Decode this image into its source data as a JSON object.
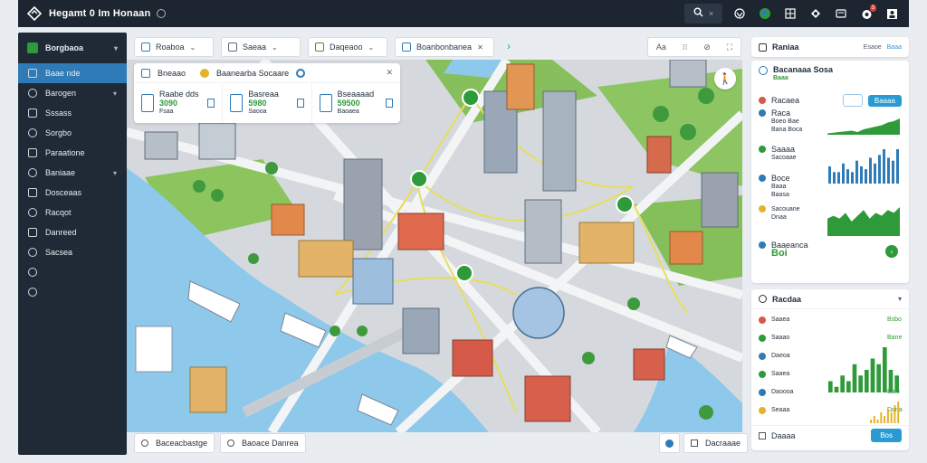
{
  "app": {
    "title": "Hegamt 0 Im Honaan"
  },
  "topbar": {
    "search_icon": "search-icon",
    "search_extra": "×",
    "icons": [
      "wifi-icon",
      "globe-icon",
      "flag-icon",
      "shield-icon",
      "message-icon",
      "alert-icon",
      "user-icon"
    ],
    "alert_badge": "3"
  },
  "sidebar": {
    "header": "Borgbaoa",
    "items": [
      {
        "label": "Baae nde",
        "active": true,
        "chevron": false
      },
      {
        "label": "Barogen",
        "active": false,
        "chevron": true
      },
      {
        "label": "Sssass",
        "active": false,
        "chevron": false
      },
      {
        "label": "Sorgbo",
        "active": false,
        "chevron": false
      },
      {
        "label": "Paraatione",
        "active": false,
        "chevron": false
      },
      {
        "label": "Baniaae",
        "active": false,
        "chevron": true
      },
      {
        "label": "Dosceaas",
        "active": false,
        "chevron": false
      },
      {
        "label": "Racqot",
        "active": false,
        "chevron": false
      },
      {
        "label": "Danreed",
        "active": false,
        "chevron": false
      },
      {
        "label": "Sacsea",
        "active": false,
        "chevron": false
      }
    ]
  },
  "filters": [
    {
      "label": "Roaboa",
      "color": "#2e7bb7"
    },
    {
      "label": "Saeaa",
      "color": "#5a6877"
    },
    {
      "label": "Daqeaoo",
      "color": "#2f9a3a"
    },
    {
      "label": "Boanbonbanea",
      "color": "#2e7bb7"
    }
  ],
  "filter_extra": "›",
  "map_controls": [
    "Aa",
    "⁝⁝",
    "⊘",
    "⛶"
  ],
  "stat_card": {
    "title": "Bneaao",
    "subtitle": "Baanearba Socaare",
    "close": "✕",
    "columns": [
      {
        "label": "Raabe dds",
        "value": "3090",
        "sub": "Fsaa"
      },
      {
        "label": "Basreaa",
        "value": "5980",
        "sub": "Saooa"
      },
      {
        "label": "Bseaaaad",
        "value": "59500",
        "sub": "Baoaea"
      }
    ]
  },
  "bottom_left": [
    {
      "label": "Baceacbastge"
    },
    {
      "label": "Baoace Danrea"
    }
  ],
  "bottom_right": {
    "label": "Dacraaae"
  },
  "right_top": {
    "title": "Raniaa",
    "box_label": "Esaoe",
    "box_btn": "Baaa",
    "header2": "Bacanaaa Sosa",
    "header2_sub": "Baaa",
    "section": "Racaea",
    "section_btn": "Baaaa",
    "rows": [
      {
        "label": "Raca",
        "sub": "Boeo Bae",
        "value": "",
        "right": "Bana Boca"
      },
      {
        "label": "Saaaa",
        "sub": "Sacoaae",
        "value": "",
        "right": ""
      },
      {
        "label": "Boce",
        "sub": "Baaa",
        "value": "",
        "right": "Baasa"
      },
      {
        "label": "",
        "sub": "Sacouane",
        "value": "",
        "right": "Dnaa"
      },
      {
        "label": "Baaeanca",
        "sub": "",
        "value": "Boi",
        "right": ""
      }
    ]
  },
  "right_bottom": {
    "title": "Racdaa",
    "rows": [
      {
        "label": "Saaea",
        "value": "Bsbo"
      },
      {
        "label": "Saaao",
        "value": "Bane"
      },
      {
        "label": "Daeoa",
        "value": ""
      },
      {
        "label": "Saaea",
        "value": ""
      },
      {
        "label": "Daoooa",
        "value": "Bale"
      },
      {
        "label": "Seaaa",
        "value": "Dana"
      }
    ],
    "footer": "Daaaa",
    "footer_btn": "Bos"
  },
  "chart_data": [
    {
      "type": "area",
      "title": "",
      "values": [
        1,
        1.5,
        2,
        2.5,
        3,
        2,
        4,
        5,
        6,
        7,
        9,
        10,
        12
      ],
      "color": "#2f9a3a"
    },
    {
      "type": "bar",
      "title": "",
      "values": [
        6,
        4,
        4,
        7,
        5,
        4,
        8,
        6,
        5,
        9,
        7,
        10,
        12,
        9,
        8,
        12
      ],
      "color": "#2e7bb7"
    },
    {
      "type": "area",
      "title": "",
      "values": [
        6,
        7,
        6,
        8,
        5,
        7,
        9,
        6,
        8,
        7,
        9,
        8,
        10
      ],
      "color": "#2f9a3a"
    },
    {
      "type": "bar",
      "title": "",
      "values": [
        2,
        1,
        3,
        2,
        5,
        3,
        4,
        6,
        5,
        8,
        4,
        3
      ],
      "color": "#2f9a3a"
    },
    {
      "type": "bar",
      "title": "",
      "values": [
        1,
        2,
        1,
        3,
        2,
        4,
        3,
        5,
        6
      ],
      "color": "#e3b42a"
    }
  ]
}
